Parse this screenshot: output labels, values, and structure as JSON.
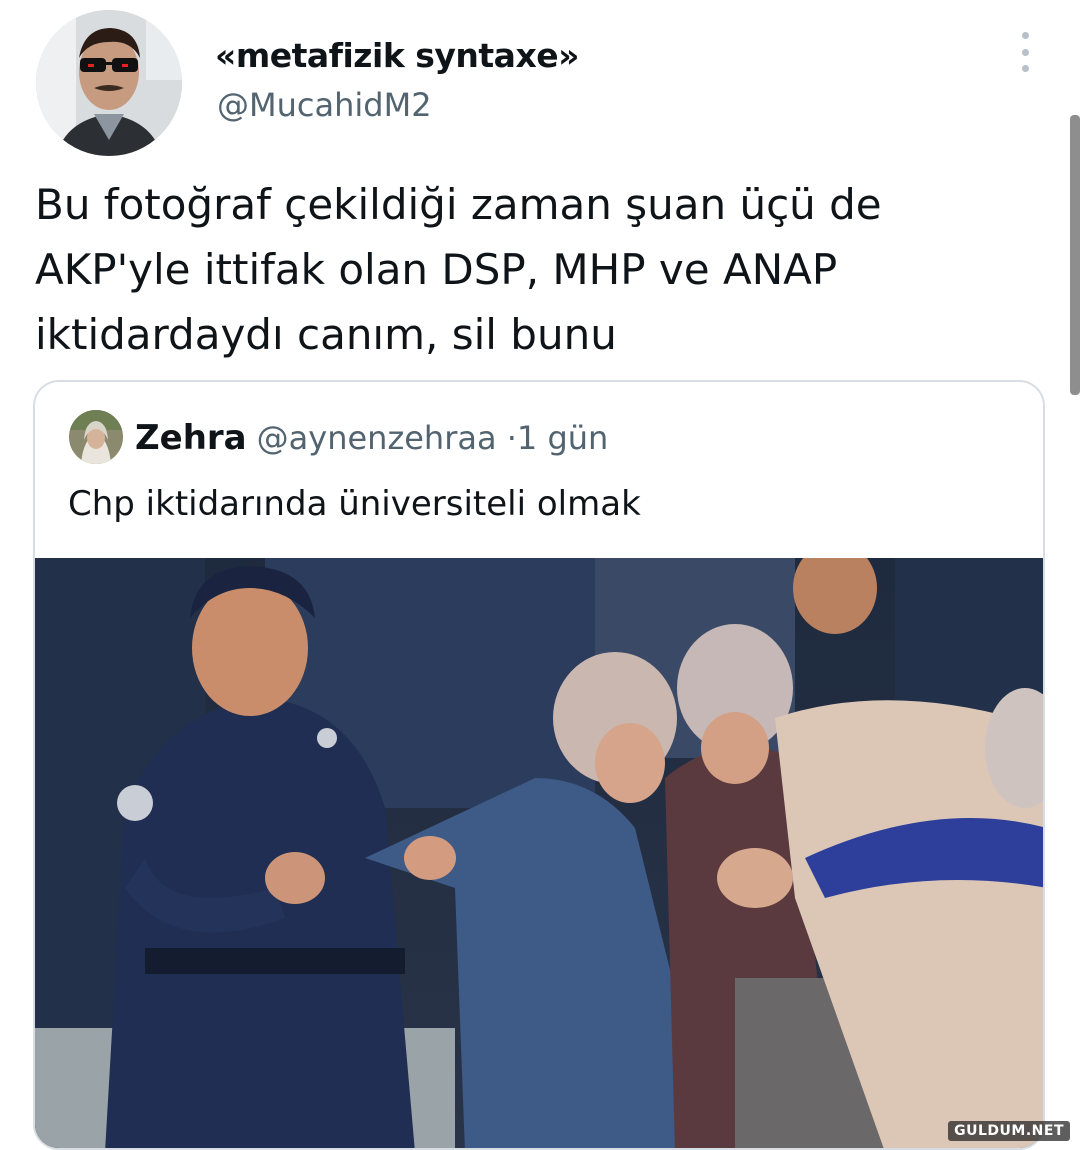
{
  "tweet": {
    "display_name": "«metafizik syntaxe»",
    "handle": "@MucahidM2",
    "text_lines": [
      "Bu fotoğraf çekildiği zaman şuan üçü de",
      "AKP'yle ittifak olan DSP, MHP ve ANAP",
      "iktidardaydı canım, sil bunu"
    ],
    "more_icon": "more-vertical-icon"
  },
  "quote": {
    "display_name": "Zehra",
    "handle": "@aynenzehraa",
    "separator": "·",
    "time": "1 gün",
    "text": "Chp iktidarında üniversiteli olmak"
  },
  "watermark": {
    "text": "GULDUM.NET"
  },
  "colors": {
    "primary_text": "#0f1419",
    "secondary_text": "#536471",
    "card_border": "#d7dde2"
  }
}
